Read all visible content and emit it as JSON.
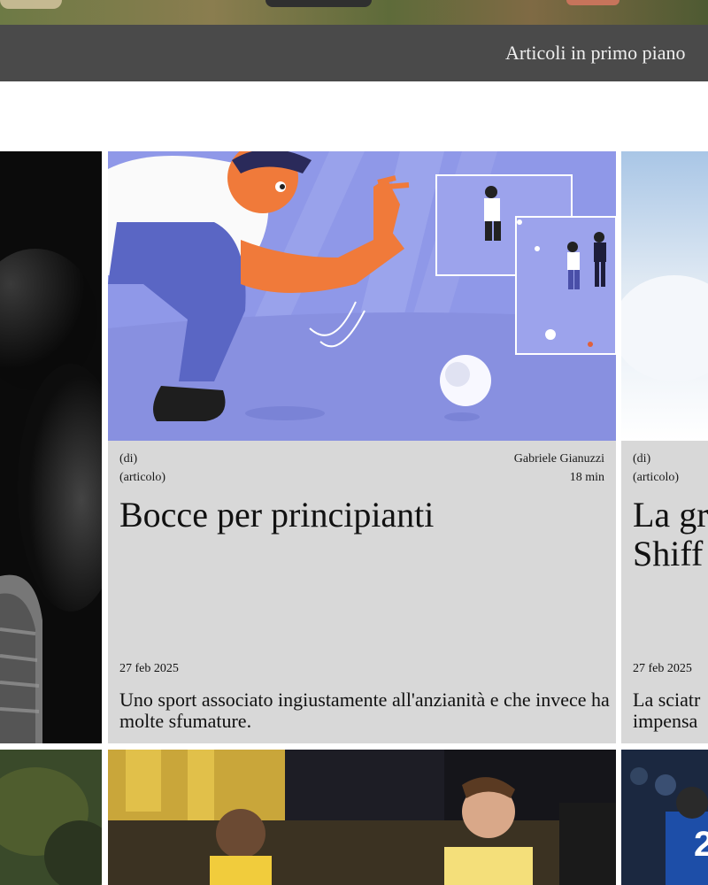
{
  "topbar": {
    "featured_link": "Articoli in primo piano"
  },
  "cards": [
    {
      "type": "(di)",
      "kind": "(articolo)",
      "author": "Gabriele Gianuzzi",
      "read_time": "18 min",
      "title": "Bocce per principianti",
      "date": "27 feb 2025",
      "summary": "Uno sport associato ingiustamente all'anzianità e che invece ha molte sfumature."
    },
    {
      "type": "(di)",
      "kind": "(articolo)",
      "title_line1": "La gr",
      "title_line2": "Shiff",
      "date": "27 feb 2025",
      "summary_line1": "La sciatr",
      "summary_line2": "impensa"
    }
  ],
  "colors": {
    "topbar_bg": "#4a4a4a",
    "card_bg": "#d8d8d8",
    "illustration_bg": "#8f98e8",
    "text": "#111111"
  },
  "icons": {
    "bocce_illustration": "bocce-player-illustration",
    "basketball_photo": "basketball-photo"
  }
}
